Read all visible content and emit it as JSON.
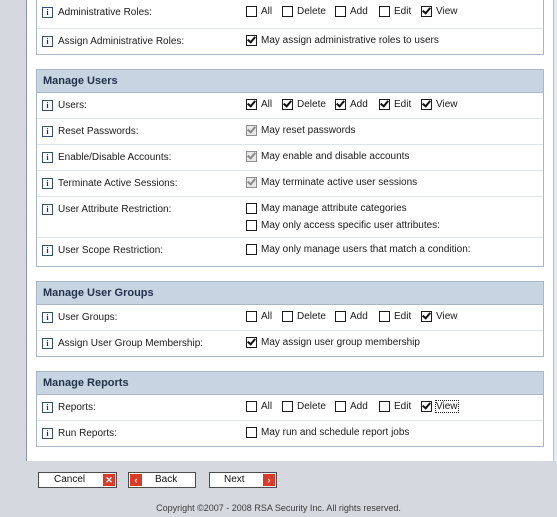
{
  "top_section": {
    "rows": [
      {
        "label": "Administrative Roles:",
        "options": [
          {
            "text": "All",
            "checked": false
          },
          {
            "text": "Delete",
            "checked": false
          },
          {
            "text": "Add",
            "checked": false
          },
          {
            "text": "Edit",
            "checked": false
          },
          {
            "text": "View",
            "checked": true
          }
        ]
      },
      {
        "label": "Assign Administrative Roles:",
        "single": {
          "text": "May assign administrative roles to users",
          "checked": true,
          "disabled": false
        }
      }
    ]
  },
  "manage_users": {
    "header": "Manage Users",
    "rows": [
      {
        "label": "Users:",
        "options": [
          {
            "text": "All",
            "checked": true
          },
          {
            "text": "Delete",
            "checked": true
          },
          {
            "text": "Add",
            "checked": true
          },
          {
            "text": "Edit",
            "checked": true
          },
          {
            "text": "View",
            "checked": true
          }
        ]
      },
      {
        "label": "Reset Passwords:",
        "single": {
          "text": "May reset passwords",
          "checked": true,
          "disabled": true
        }
      },
      {
        "label": "Enable/Disable Accounts:",
        "single": {
          "text": "May enable and disable accounts",
          "checked": true,
          "disabled": true
        }
      },
      {
        "label": "Terminate Active Sessions:",
        "single": {
          "text": "May terminate active user sessions",
          "checked": true,
          "disabled": true
        }
      },
      {
        "label": "User Attribute Restriction:",
        "multi": [
          {
            "text": "May manage attribute categories",
            "checked": false
          },
          {
            "text": "May only access specific user attributes:",
            "checked": false
          }
        ]
      },
      {
        "label": "User Scope Restriction:",
        "single": {
          "text": "May only manage users that match a condition:",
          "checked": false,
          "disabled": false
        }
      }
    ]
  },
  "manage_user_groups": {
    "header": "Manage User Groups",
    "rows": [
      {
        "label": "User Groups:",
        "options": [
          {
            "text": "All",
            "checked": false
          },
          {
            "text": "Delete",
            "checked": false
          },
          {
            "text": "Add",
            "checked": false
          },
          {
            "text": "Edit",
            "checked": false
          },
          {
            "text": "View",
            "checked": true
          }
        ]
      },
      {
        "label": "Assign User Group Membership:",
        "single": {
          "text": "May assign user group membership",
          "checked": true,
          "disabled": false
        }
      }
    ]
  },
  "manage_reports": {
    "header": "Manage Reports",
    "rows": [
      {
        "label": "Reports:",
        "options": [
          {
            "text": "All",
            "checked": false
          },
          {
            "text": "Delete",
            "checked": false
          },
          {
            "text": "Add",
            "checked": false
          },
          {
            "text": "Edit",
            "checked": false
          },
          {
            "text": "View",
            "checked": true,
            "focused": true
          }
        ]
      },
      {
        "label": "Run Reports:",
        "single": {
          "text": "May run and schedule report jobs",
          "checked": false,
          "disabled": false
        }
      }
    ]
  },
  "buttons": {
    "cancel": {
      "label": "Cancel",
      "icon": "close-icon"
    },
    "back": {
      "label": "Back",
      "icon": "back-arrow-icon"
    },
    "next": {
      "label": "Next",
      "icon": "next-arrow-icon"
    }
  },
  "footer": "Copyright ©2007 - 2008 RSA Security Inc. All rights reserved.",
  "colors": {
    "section_header_bg": "#c7d4e2",
    "button_icon": "#d93a2a",
    "info_icon_border": "#37506e"
  }
}
